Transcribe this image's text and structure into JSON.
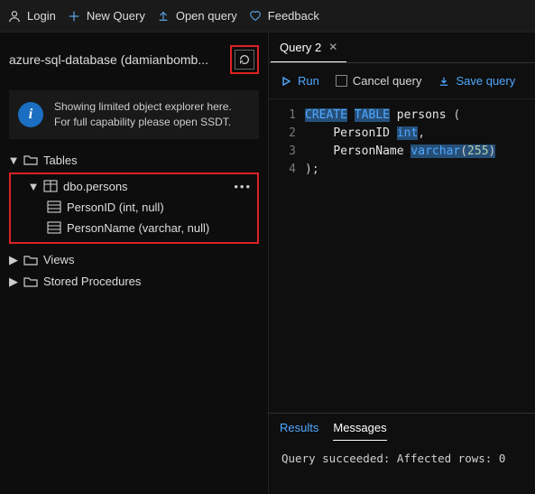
{
  "topbar": {
    "login": "Login",
    "new_query": "New Query",
    "open_query": "Open query",
    "feedback": "Feedback"
  },
  "connection": {
    "name": "azure-sql-database (damianbomb..."
  },
  "info": {
    "line1": "Showing limited object explorer here.",
    "line2": "For full capability please open SSDT."
  },
  "tree": {
    "tables_label": "Tables",
    "table_name": "dbo.persons",
    "columns": [
      "PersonID (int, null)",
      "PersonName (varchar, null)"
    ],
    "views_label": "Views",
    "sprocs_label": "Stored Procedures"
  },
  "tab": {
    "title": "Query 2"
  },
  "toolbar": {
    "run": "Run",
    "cancel": "Cancel query",
    "save": "Save query"
  },
  "code": {
    "lines": [
      "1",
      "2",
      "3",
      "4"
    ],
    "l1_kw1": "CREATE",
    "l1_kw2": "TABLE",
    "l1_ident": "persons",
    "l1_paren": "(",
    "l2_ident": "PersonID",
    "l2_ty": "int",
    "l2_comma": ",",
    "l3_ident": "PersonName",
    "l3_ty": "varchar",
    "l3_open": "(",
    "l3_num": "255",
    "l3_close": ")",
    "l4_close": ");"
  },
  "results": {
    "tab_results": "Results",
    "tab_messages": "Messages",
    "status": "Query succeeded: Affected rows: 0"
  }
}
